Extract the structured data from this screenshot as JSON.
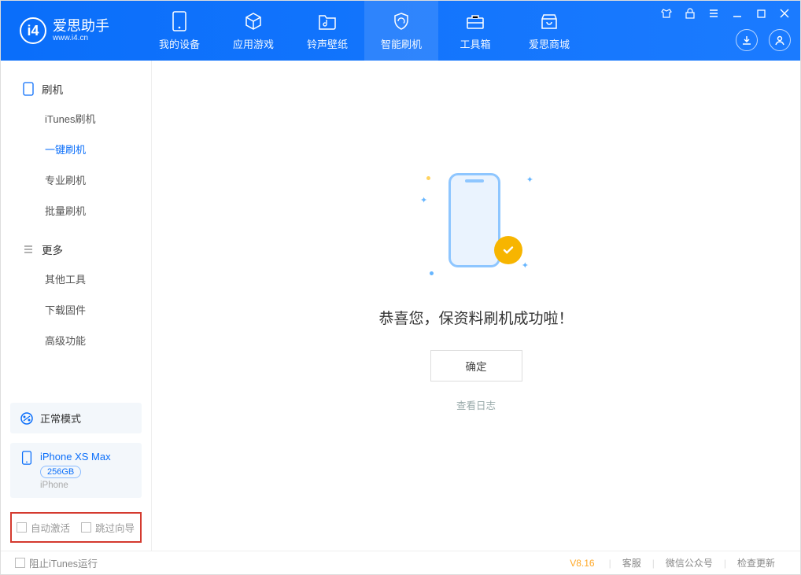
{
  "app": {
    "name": "爱思助手",
    "domain": "www.i4.cn"
  },
  "nav": [
    {
      "label": "我的设备"
    },
    {
      "label": "应用游戏"
    },
    {
      "label": "铃声壁纸"
    },
    {
      "label": "智能刷机"
    },
    {
      "label": "工具箱"
    },
    {
      "label": "爱思商城"
    }
  ],
  "sidebar": {
    "group1": {
      "title": "刷机",
      "items": [
        "iTunes刷机",
        "一键刷机",
        "专业刷机",
        "批量刷机"
      ],
      "activeIndex": 1
    },
    "group2": {
      "title": "更多",
      "items": [
        "其他工具",
        "下载固件",
        "高级功能"
      ]
    },
    "mode": {
      "label": "正常模式"
    },
    "device": {
      "name": "iPhone XS Max",
      "storage": "256GB",
      "type": "iPhone"
    },
    "checkboxes": {
      "autoActivate": "自动激活",
      "skipGuide": "跳过向导"
    }
  },
  "main": {
    "successText": "恭喜您，保资料刷机成功啦！",
    "okButton": "确定",
    "viewLog": "查看日志"
  },
  "footer": {
    "blockItunes": "阻止iTunes运行",
    "version": "V8.16",
    "links": [
      "客服",
      "微信公众号",
      "检查更新"
    ]
  }
}
